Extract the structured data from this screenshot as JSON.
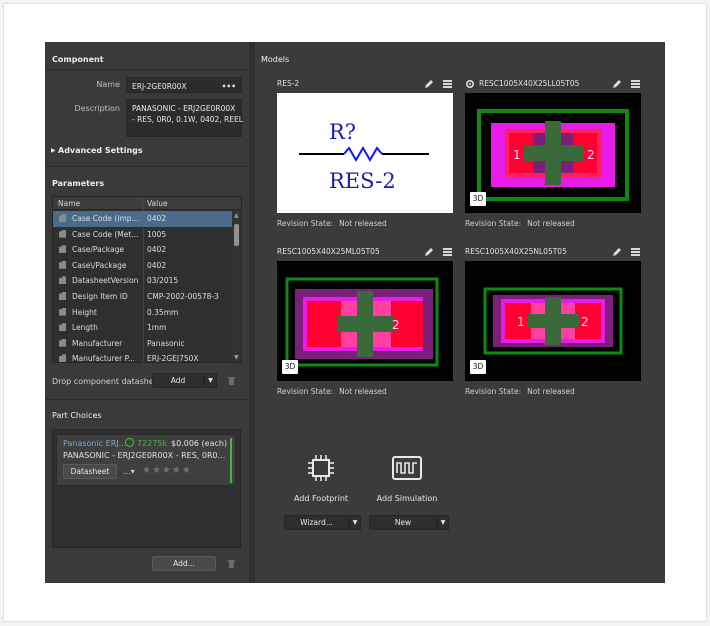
{
  "component": {
    "section_title": "Component",
    "name_label": "Name",
    "name_value": "ERJ-2GE0R00X",
    "name_button": "•••",
    "description_label": "Description",
    "description_line1": "PANASONIC - ERJ2GE0R00X",
    "description_line2": "- RES, 0R0, 0.1W, 0402, REEL",
    "advanced_toggle": "▶",
    "advanced_label": "Advanced Settings"
  },
  "parameters": {
    "section_title": "Parameters",
    "col_name": "Name",
    "col_value": "Value",
    "rows": [
      {
        "name": "Case Code (Imp...",
        "value": "0402"
      },
      {
        "name": "Case Code (Met...",
        "value": "1005"
      },
      {
        "name": "Case/Package",
        "value": "0402"
      },
      {
        "name": "Case\\/Package",
        "value": "0402"
      },
      {
        "name": "DatasheetVersion",
        "value": "03/2015"
      },
      {
        "name": "Design Item ID",
        "value": "CMP-2002-00578-3"
      },
      {
        "name": "Height",
        "value": "0.35mm"
      },
      {
        "name": "Length",
        "value": "1mm"
      },
      {
        "name": "Manufacturer",
        "value": "Panasonic"
      },
      {
        "name": "Manufacturer P...",
        "value": "ERJ-2GEJ750X"
      }
    ],
    "selected_row": 0,
    "drop_label": "Drop component datashe",
    "add_label": "Add",
    "dropdown_arrow": "▼"
  },
  "part_choices": {
    "section_title": "Part Choices",
    "supplier": "Panasonic ERJ...",
    "stock": "72275k",
    "price": "$0.006 (each)",
    "description": "PANASONIC - ERJ2GE0R00X - RES, 0R0...",
    "datasheet_label": "Datasheet",
    "more_label": "...▾",
    "stars": "★★★★★",
    "add_label": "Add..."
  },
  "models": {
    "section_title": "Models",
    "cards": [
      {
        "title": "RES-2",
        "kind": "symbol",
        "revision_key": "Revision State:",
        "revision_value": "Not released"
      },
      {
        "title": "RESC1005X40X25LL05T05",
        "kind": "footprint",
        "badge": "3D",
        "revision_key": "Revision State:",
        "revision_value": "Not released"
      },
      {
        "title": "RESC1005X40X25ML05T05",
        "kind": "footprint",
        "badge": "3D",
        "revision_key": "Revision State:",
        "revision_value": "Not released"
      },
      {
        "title": "RESC1005X40X25NL05T05",
        "kind": "footprint",
        "badge": "3D",
        "revision_key": "Revision State:",
        "revision_value": "Not released"
      }
    ],
    "symbol_designator": "R?",
    "symbol_comment": "RES-2",
    "pad1": "1",
    "pad2": "2",
    "add_footprint_label": "Add Footprint",
    "add_simulation_label": "Add Simulation",
    "wizard_label": "Wizard...",
    "new_label": "New",
    "dropdown_arrow": "▼"
  },
  "colors": {
    "accent_selected": "#4b6b8d",
    "stock_green": "#43b840",
    "outline_green": "#0d8a12",
    "pad_magenta": "#ff00ff",
    "body_red": "#ff0033",
    "courtyard_purple": "#7a1f7a"
  }
}
